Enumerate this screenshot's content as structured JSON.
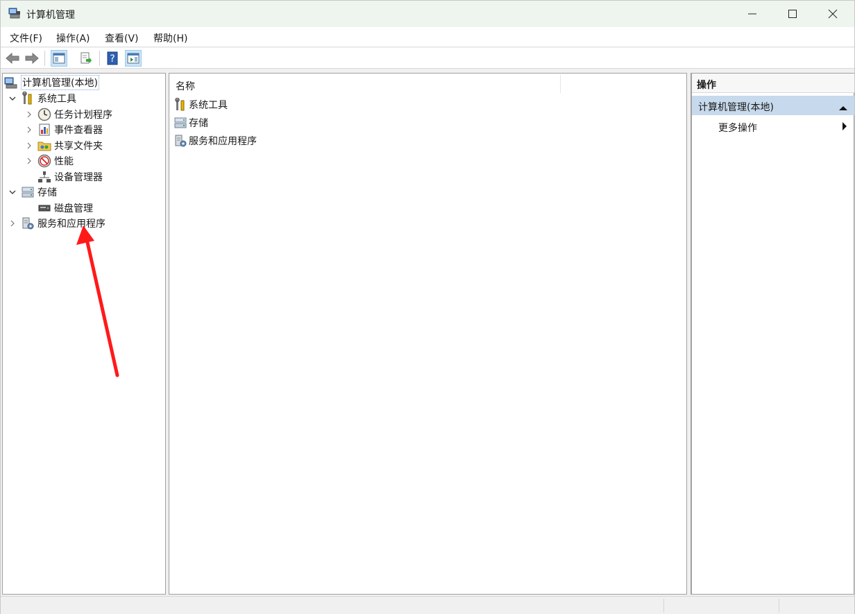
{
  "window": {
    "title": "计算机管理"
  },
  "menubar": {
    "items": [
      {
        "label": "文件(F)"
      },
      {
        "label": "操作(A)"
      },
      {
        "label": "查看(V)"
      },
      {
        "label": "帮助(H)"
      }
    ]
  },
  "tree": {
    "items": [
      {
        "label": "计算机管理(本地)",
        "icon": "computer-management-icon",
        "expanded": true,
        "selected": true
      },
      {
        "label": "系统工具",
        "icon": "system-tools-icon",
        "expanded": true
      },
      {
        "label": "任务计划程序",
        "icon": "clock-icon",
        "expanded": false
      },
      {
        "label": "事件查看器",
        "icon": "event-viewer-icon",
        "expanded": false
      },
      {
        "label": "共享文件夹",
        "icon": "shared-folder-icon",
        "expanded": false
      },
      {
        "label": "性能",
        "icon": "performance-icon",
        "expanded": false
      },
      {
        "label": "设备管理器",
        "icon": "device-manager-icon"
      },
      {
        "label": "存储",
        "icon": "storage-icon",
        "expanded": true
      },
      {
        "label": "磁盘管理",
        "icon": "disk-management-icon"
      },
      {
        "label": "服务和应用程序",
        "icon": "services-icon",
        "expanded": false
      }
    ]
  },
  "list": {
    "header": {
      "name": "名称"
    },
    "items": [
      {
        "label": "系统工具",
        "icon": "system-tools-icon"
      },
      {
        "label": "存储",
        "icon": "storage-icon"
      },
      {
        "label": "服务和应用程序",
        "icon": "services-icon"
      }
    ]
  },
  "actions": {
    "header": "操作",
    "group": "计算机管理(本地)",
    "more": "更多操作"
  },
  "colors": {
    "annotation_arrow": "#ff1a1a",
    "selected_group": "#c7d9ec",
    "titlebar": "#eef5ee"
  }
}
